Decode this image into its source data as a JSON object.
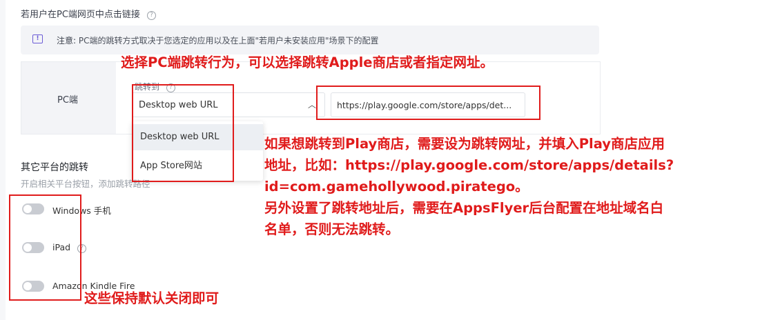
{
  "section": {
    "title": "若用户在PC端网页中点击链接",
    "help_glyph": "?"
  },
  "notice": {
    "prefix": "注意:",
    "text": " PC端的跳转方式取决于您选定的应用以及在上面\"若用户未安装应用\"场景下的配置"
  },
  "pc": {
    "row_label": "PC端",
    "jump_label": "跳转到",
    "select_value": "Desktop web URL",
    "url_value": "https://play.google.com/store/apps/det...",
    "dropdown_options": [
      "Desktop web URL",
      "App Store网站"
    ]
  },
  "other": {
    "title": "其它平台的跳转",
    "subtitle": "开启相关平台按钮，添加跳转路径",
    "toggles": [
      {
        "label": "Windows 手机",
        "on": false
      },
      {
        "label": "iPad",
        "on": false
      },
      {
        "label": "Amazon Kindle Fire",
        "on": false
      }
    ]
  },
  "annotations": {
    "a1": "选择PC端跳转行为，可以选择跳转Apple商店或者指定网址。",
    "a2_lines": [
      "如果想跳转到Play商店，需要设为跳转网址，并填入Play商店应用",
      "地址，比如：https://play.google.com/store/apps/details?",
      "id=com.gamehollywood.piratego。",
      "另外设置了跳转地址后，需要在AppsFlyer后台配置在地址域名白",
      "名单，否则无法跳转。"
    ],
    "a3": "这些保持默认关闭即可"
  },
  "colors": {
    "accent": "#6b5bd6",
    "annotation_red": "#e01b1b",
    "toggle_off": "#c9ccd2"
  }
}
